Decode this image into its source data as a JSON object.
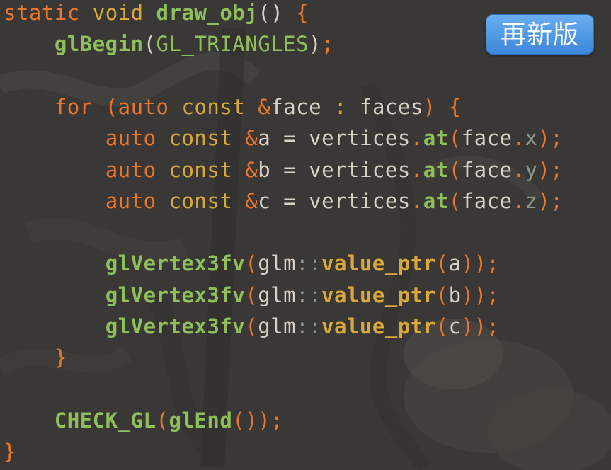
{
  "badge": {
    "label": "再新版"
  },
  "colors": {
    "background": "#3a3936",
    "keyword": "#e8762b",
    "type": "#d9a83a",
    "function": "#8fbf5a",
    "plain": "#d8d2c4",
    "field": "#8a9a8a",
    "badge": "#4b93e0"
  },
  "code": {
    "lines": [
      {
        "tokens": [
          {
            "t": "static",
            "c": "keyword"
          },
          {
            "t": " "
          },
          {
            "t": "void",
            "c": "type"
          },
          {
            "t": " "
          },
          {
            "t": "draw_obj",
            "c": "funcbold"
          },
          {
            "t": "()",
            "c": "plain"
          },
          {
            "t": " "
          },
          {
            "t": "{",
            "c": "keyword"
          }
        ]
      },
      {
        "tokens": [
          {
            "t": "    "
          },
          {
            "t": "glBegin",
            "c": "funcbold"
          },
          {
            "t": "(",
            "c": "plain"
          },
          {
            "t": "GL_TRIANGLES",
            "c": "function"
          },
          {
            "t": ")",
            "c": "plain"
          },
          {
            "t": ";",
            "c": "keyword"
          }
        ]
      },
      {
        "tokens": []
      },
      {
        "tokens": [
          {
            "t": "    "
          },
          {
            "t": "for",
            "c": "keyword"
          },
          {
            "t": " "
          },
          {
            "t": "(",
            "c": "keyword"
          },
          {
            "t": "auto",
            "c": "keyword"
          },
          {
            "t": " "
          },
          {
            "t": "const",
            "c": "type"
          },
          {
            "t": " "
          },
          {
            "t": "&",
            "c": "keyword"
          },
          {
            "t": "face",
            "c": "plain"
          },
          {
            "t": " "
          },
          {
            "t": ":",
            "c": "type"
          },
          {
            "t": " "
          },
          {
            "t": "faces",
            "c": "plain"
          },
          {
            "t": ")",
            "c": "keyword"
          },
          {
            "t": " "
          },
          {
            "t": "{",
            "c": "keyword"
          }
        ]
      },
      {
        "tokens": [
          {
            "t": "        "
          },
          {
            "t": "auto",
            "c": "keyword"
          },
          {
            "t": " "
          },
          {
            "t": "const",
            "c": "type"
          },
          {
            "t": " "
          },
          {
            "t": "&",
            "c": "keyword"
          },
          {
            "t": "a",
            "c": "plain"
          },
          {
            "t": " = ",
            "c": "plain"
          },
          {
            "t": "vertices",
            "c": "plain"
          },
          {
            "t": ".",
            "c": "keyword"
          },
          {
            "t": "at",
            "c": "funcbold"
          },
          {
            "t": "(",
            "c": "keyword"
          },
          {
            "t": "face",
            "c": "plain"
          },
          {
            "t": ".",
            "c": "keyword"
          },
          {
            "t": "x",
            "c": "field"
          },
          {
            "t": ")",
            "c": "keyword"
          },
          {
            "t": ";",
            "c": "keyword"
          }
        ]
      },
      {
        "tokens": [
          {
            "t": "        "
          },
          {
            "t": "auto",
            "c": "keyword"
          },
          {
            "t": " "
          },
          {
            "t": "const",
            "c": "type"
          },
          {
            "t": " "
          },
          {
            "t": "&",
            "c": "keyword"
          },
          {
            "t": "b",
            "c": "plain"
          },
          {
            "t": " = ",
            "c": "plain"
          },
          {
            "t": "vertices",
            "c": "plain"
          },
          {
            "t": ".",
            "c": "keyword"
          },
          {
            "t": "at",
            "c": "funcbold"
          },
          {
            "t": "(",
            "c": "keyword"
          },
          {
            "t": "face",
            "c": "plain"
          },
          {
            "t": ".",
            "c": "keyword"
          },
          {
            "t": "y",
            "c": "field"
          },
          {
            "t": ")",
            "c": "keyword"
          },
          {
            "t": ";",
            "c": "keyword"
          }
        ]
      },
      {
        "tokens": [
          {
            "t": "        "
          },
          {
            "t": "auto",
            "c": "keyword"
          },
          {
            "t": " "
          },
          {
            "t": "const",
            "c": "type"
          },
          {
            "t": " "
          },
          {
            "t": "&",
            "c": "keyword"
          },
          {
            "t": "c",
            "c": "plain"
          },
          {
            "t": " = ",
            "c": "plain"
          },
          {
            "t": "vertices",
            "c": "plain"
          },
          {
            "t": ".",
            "c": "keyword"
          },
          {
            "t": "at",
            "c": "funcbold"
          },
          {
            "t": "(",
            "c": "keyword"
          },
          {
            "t": "face",
            "c": "plain"
          },
          {
            "t": ".",
            "c": "keyword"
          },
          {
            "t": "z",
            "c": "field"
          },
          {
            "t": ")",
            "c": "keyword"
          },
          {
            "t": ";",
            "c": "keyword"
          }
        ]
      },
      {
        "tokens": []
      },
      {
        "tokens": [
          {
            "t": "        "
          },
          {
            "t": "glVertex3fv",
            "c": "funcbold"
          },
          {
            "t": "(",
            "c": "keyword"
          },
          {
            "t": "glm",
            "c": "plain"
          },
          {
            "t": "::",
            "c": "field"
          },
          {
            "t": "value_ptr",
            "c": "typebold"
          },
          {
            "t": "(",
            "c": "keyword"
          },
          {
            "t": "a",
            "c": "plain"
          },
          {
            "t": "))",
            "c": "keyword"
          },
          {
            "t": ";",
            "c": "keyword"
          }
        ]
      },
      {
        "tokens": [
          {
            "t": "        "
          },
          {
            "t": "glVertex3fv",
            "c": "funcbold"
          },
          {
            "t": "(",
            "c": "keyword"
          },
          {
            "t": "glm",
            "c": "plain"
          },
          {
            "t": "::",
            "c": "field"
          },
          {
            "t": "value_ptr",
            "c": "typebold"
          },
          {
            "t": "(",
            "c": "keyword"
          },
          {
            "t": "b",
            "c": "plain"
          },
          {
            "t": "))",
            "c": "keyword"
          },
          {
            "t": ";",
            "c": "keyword"
          }
        ]
      },
      {
        "tokens": [
          {
            "t": "        "
          },
          {
            "t": "glVertex3fv",
            "c": "funcbold"
          },
          {
            "t": "(",
            "c": "keyword"
          },
          {
            "t": "glm",
            "c": "plain"
          },
          {
            "t": "::",
            "c": "field"
          },
          {
            "t": "value_ptr",
            "c": "typebold"
          },
          {
            "t": "(",
            "c": "keyword"
          },
          {
            "t": "c",
            "c": "plain"
          },
          {
            "t": "))",
            "c": "keyword"
          },
          {
            "t": ";",
            "c": "keyword"
          }
        ]
      },
      {
        "tokens": [
          {
            "t": "    "
          },
          {
            "t": "}",
            "c": "keyword"
          }
        ]
      },
      {
        "tokens": []
      },
      {
        "tokens": [
          {
            "t": "    "
          },
          {
            "t": "CHECK_GL",
            "c": "funcbold"
          },
          {
            "t": "(",
            "c": "keyword"
          },
          {
            "t": "glEnd",
            "c": "funcbold"
          },
          {
            "t": "())",
            "c": "keyword"
          },
          {
            "t": ";",
            "c": "keyword"
          }
        ]
      },
      {
        "tokens": [
          {
            "t": "}",
            "c": "keyword"
          }
        ]
      }
    ]
  }
}
